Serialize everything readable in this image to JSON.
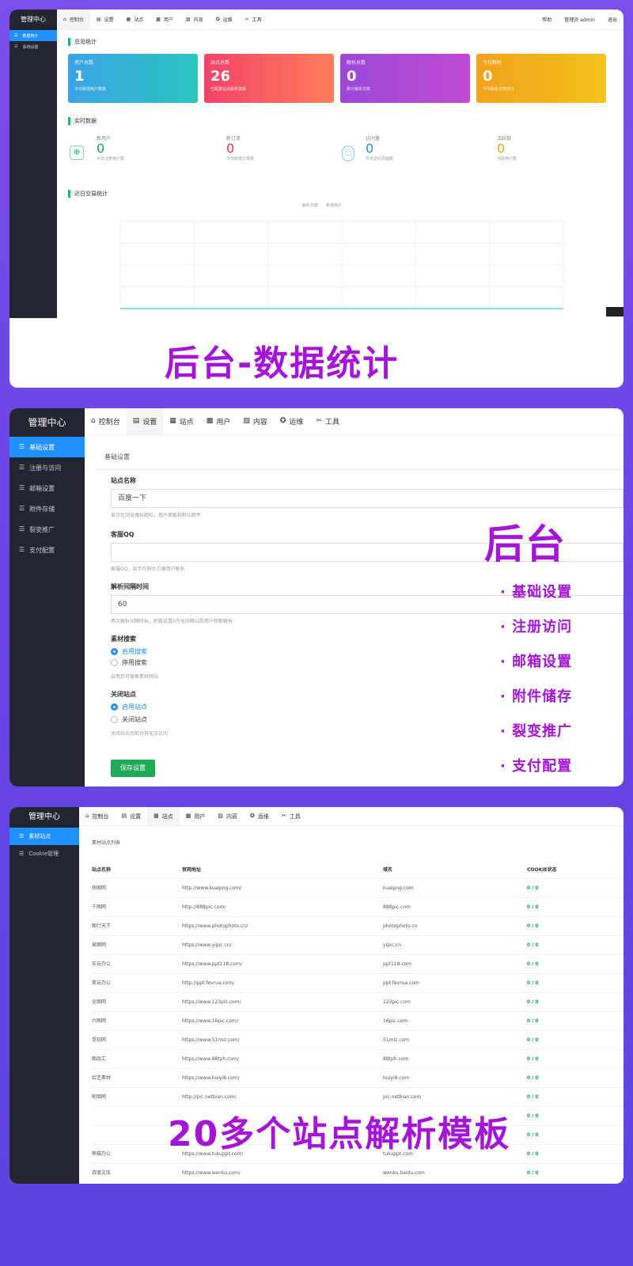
{
  "card1": {
    "sidebar": {
      "title": "管理中心",
      "items": [
        {
          "label": "数据统计",
          "active": true
        },
        {
          "label": "系统设置",
          "active": false
        }
      ]
    },
    "topnav": {
      "items": [
        "控制台",
        "设置",
        "站点",
        "用户",
        "内容",
        "运维",
        "工具"
      ],
      "right": [
        "帮助",
        "管理员 admin",
        "退出"
      ]
    },
    "overview_title": "总览统计",
    "stats": [
      {
        "label": "用户总数",
        "value": "1",
        "sub": "今日新增用户数量",
        "color1": "#2bb5c6",
        "color2": "#3ba3e6"
      },
      {
        "label": "站点总数",
        "value": "26",
        "sub": "已配置站点解析模板",
        "color1": "#f3436a",
        "color2": "#ff7d59"
      },
      {
        "label": "解析总数",
        "value": "0",
        "sub": "累计解析次数",
        "color1": "#a347d8",
        "color2": "#c04ad2"
      },
      {
        "label": "今日解析",
        "value": "0",
        "sub": "今日解析次数统计",
        "color1": "#f2a31b",
        "color2": "#f3c21c"
      }
    ],
    "realtime_title": "实时数据",
    "realtime": [
      {
        "label": "新用户",
        "value": "0",
        "sub": "今日注册用户数",
        "color": "#10a37f"
      },
      {
        "label": "新订单",
        "value": "0",
        "sub": "今日新增订单数",
        "color": "#e53935"
      },
      {
        "label": "访问量",
        "value": "0",
        "sub": "今日访问页面数",
        "color": "#1e90ff"
      },
      {
        "label": "活跃数",
        "value": "0",
        "sub": "活跃用户数",
        "color": "#f2a31b"
      }
    ],
    "chart_title": "近日交易统计",
    "chart_legend": [
      "解析次数",
      "新增用户"
    ],
    "chart_data": {
      "type": "line",
      "x": [
        "",
        "",
        "",
        "",
        "",
        "",
        ""
      ],
      "series": [
        {
          "name": "",
          "values": [
            0,
            0,
            0,
            0,
            0,
            0,
            0
          ]
        }
      ],
      "yticks": [
        "",
        "",
        "",
        ""
      ]
    },
    "banner": "后台-数据统计"
  },
  "card2": {
    "sidebar": {
      "title": "管理中心",
      "items": [
        {
          "label": "基础设置",
          "active": true
        },
        {
          "label": "注册与访问",
          "active": false
        },
        {
          "label": "邮箱设置",
          "active": false
        },
        {
          "label": "附件存储",
          "active": false
        },
        {
          "label": "裂变推广",
          "active": false
        },
        {
          "label": "支付配置",
          "active": false
        }
      ]
    },
    "topnav": {
      "items": [
        "控制台",
        "设置",
        "站点",
        "用户",
        "内容",
        "运维",
        "工具"
      ]
    },
    "section": "基础设置",
    "fields": [
      {
        "label": "站点名称",
        "value": "百度一下",
        "hint": "显示在浏览器标题栏，用户面板和默认邮件"
      },
      {
        "label": "客服QQ",
        "value": "",
        "hint": "客服QQ，显示在前台方便用户联系"
      },
      {
        "label": "解析间隔时间",
        "value": "60",
        "hint": "两次解析间隔时长，秒数设置0为无间隔以防用户频繁解析"
      }
    ],
    "radio1": {
      "label": "素材搜索",
      "options": [
        "启用搜索",
        "停用搜索"
      ],
      "selected": 0,
      "hint": "启用后可搜索素材网站"
    },
    "radio2": {
      "label": "关闭站点",
      "options": [
        "启用站点",
        "关闭站点"
      ],
      "selected": 0,
      "hint": "关闭站点后前台将无法访问"
    },
    "save": "保存设置",
    "overlay_title": "后台",
    "features": [
      "· 基础设置",
      "· 注册访问",
      "· 邮箱设置",
      "· 附件储存",
      "· 裂变推广",
      "· 支付配置"
    ]
  },
  "card3": {
    "sidebar": {
      "title": "管理中心",
      "items": [
        {
          "label": "素材站点",
          "active": true
        },
        {
          "label": "Cookie管理",
          "active": false
        }
      ]
    },
    "topnav": {
      "items": [
        "控制台",
        "设置",
        "站点",
        "用户",
        "内容",
        "运维",
        "工具"
      ]
    },
    "section": "素材站点列表",
    "headers": [
      "站点名称",
      "官网地址",
      "域名",
      "COOKIE状态"
    ],
    "rows": [
      [
        "快图网",
        "http://www.kuaipng.com/",
        "kuaipng.com",
        "0 / 0"
      ],
      [
        "千图网",
        "http://888pic.com/",
        "888pic.com",
        "0 / 0"
      ],
      [
        "图行天下",
        "https://www.photophoto.cn/",
        "photophoto.cn",
        "0 / 0"
      ],
      [
        "易图网",
        "https://www.yipic.cn/",
        "yipic.cn",
        "0 / 0"
      ],
      [
        "实云办公",
        "https://www.ppt118.com/",
        "ppt118.com",
        "0 / 0"
      ],
      [
        "笑云办公",
        "http://ppt.fevrua.com/",
        "ppt.fevrua.com",
        "0 / 0"
      ],
      [
        "全图网",
        "https://www.123pic.com/",
        "123pic.com",
        "0 / 0"
      ],
      [
        "六图网",
        "https://www.16pic.com/",
        "16pic.com",
        "0 / 0"
      ],
      [
        "觅知网",
        "https://www.51miz.com/",
        "51miz.com",
        "0 / 0"
      ],
      [
        "图品汇",
        "https://www.88tph.com/",
        "88tph.com",
        "0 / 0"
      ],
      [
        "绘艺素材",
        "https://www.huiyi8.com/",
        "huiyi8.com",
        "0 / 0"
      ],
      [
        "昵图网",
        "http://pic.netbian.com/",
        "pic.netbian.com",
        "0 / 0"
      ],
      [
        "",
        "",
        "",
        "0 / 0"
      ],
      [
        "",
        "",
        "",
        "0 / 0"
      ],
      [
        "熊猫办公",
        "https://www.tukuppt.com/",
        "tukuppt.com",
        "0 / 0"
      ],
      [
        "百度文库",
        "https://www.wenku.com/",
        "wenku.baidu.com",
        "0 / 0"
      ]
    ],
    "banner": "20多个站点解析模板"
  }
}
